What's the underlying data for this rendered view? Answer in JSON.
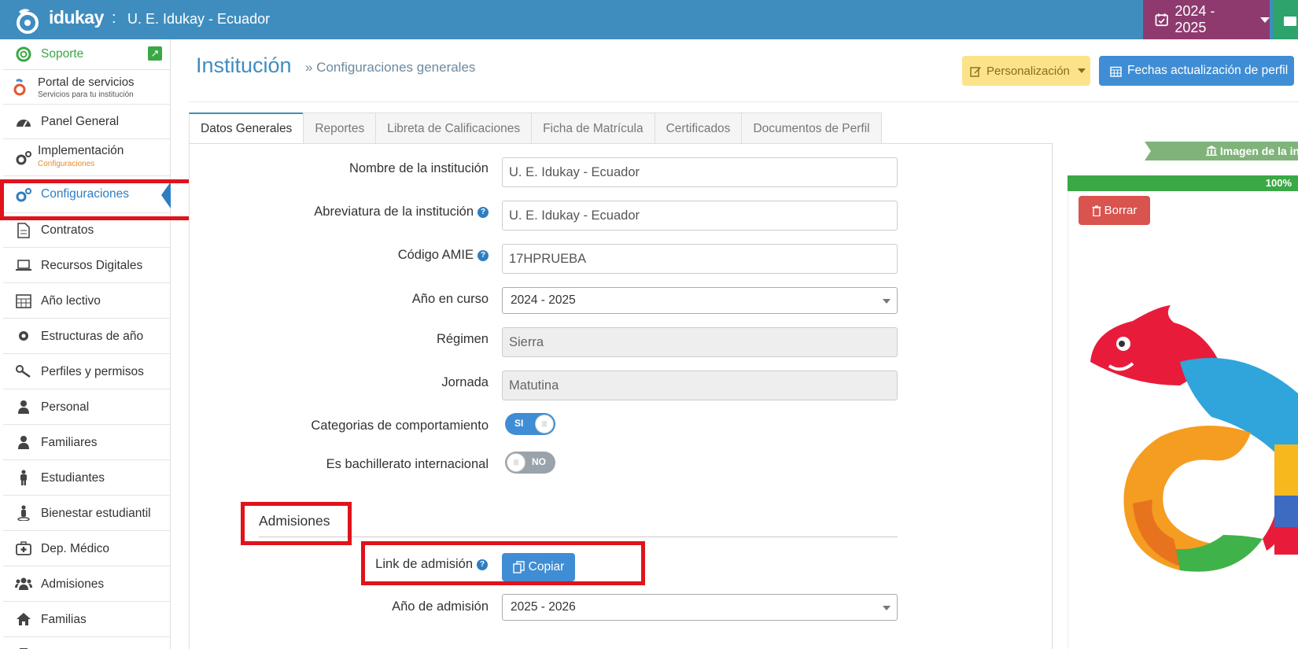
{
  "topbar": {
    "brand": "idukay",
    "separator": ":",
    "institution": "U. E. Idukay - Ecuador",
    "year": "2024 - 2025"
  },
  "sidebar": {
    "items": [
      {
        "label": "Soporte",
        "icon": "lifebuoy-icon"
      },
      {
        "label": "Portal de servicios",
        "sublabel": "Servicios para tu institución",
        "icon": "portal-icon"
      },
      {
        "label": "Panel General",
        "icon": "dashboard-icon"
      },
      {
        "label": "Implementación",
        "sublabel": "Configuraciones",
        "icon": "gears-icon"
      },
      {
        "label": "Configuraciones",
        "icon": "gears-icon",
        "active": true
      },
      {
        "label": "Contratos",
        "icon": "document-icon"
      },
      {
        "label": "Recursos Digitales",
        "icon": "laptop-icon"
      },
      {
        "label": "Año lectivo",
        "icon": "calendar-icon"
      },
      {
        "label": "Estructuras de año",
        "icon": "gear-icon"
      },
      {
        "label": "Perfiles y permisos",
        "icon": "key-icon"
      },
      {
        "label": "Personal",
        "icon": "user-icon"
      },
      {
        "label": "Familiares",
        "icon": "user-icon"
      },
      {
        "label": "Estudiantes",
        "icon": "child-icon"
      },
      {
        "label": "Bienestar estudiantil",
        "icon": "person-icon"
      },
      {
        "label": "Dep. Médico",
        "icon": "medkit-icon"
      },
      {
        "label": "Admisiones",
        "icon": "users-icon"
      },
      {
        "label": "Familias",
        "icon": "home-icon"
      }
    ]
  },
  "header": {
    "title": "Institución",
    "breadcrumb": "» Configuraciones generales",
    "personalizacion": "Personalización",
    "fechas": "Fechas actualización de perfil"
  },
  "tabs": [
    "Datos Generales",
    "Reportes",
    "Libreta de Calificaciones",
    "Ficha de Matrícula",
    "Certificados",
    "Documentos de Perfil"
  ],
  "form": {
    "nombre_label": "Nombre de la institución",
    "nombre_value": "U. E. Idukay - Ecuador",
    "abrev_label": "Abreviatura de la institución",
    "abrev_value": "U. E. Idukay - Ecuador",
    "amie_label": "Código AMIE",
    "amie_value": "17HPRUEBA",
    "anio_label": "Año en curso",
    "anio_value": "2024 - 2025",
    "regimen_label": "Régimen",
    "regimen_value": "Sierra",
    "jornada_label": "Jornada",
    "jornada_value": "Matutina",
    "categorias_label": "Categorias de comportamiento",
    "categorias_toggle": "SI",
    "bachillerato_label": "Es bachillerato internacional",
    "bachillerato_toggle": "NO",
    "admisiones_title": "Admisiones",
    "link_label": "Link de admisión",
    "copiar": "Copiar",
    "anio_admision_label": "Año de admisión",
    "anio_admision_value": "2025 - 2026"
  },
  "image_panel": {
    "banner": "Imagen de la ins",
    "progress": "100%",
    "borrar": "Borrar"
  },
  "colors": {
    "topbar": "#3f8dbf",
    "year_select": "#8e3a6f",
    "accent": "#3f8dd4",
    "highlight": "#e0121b",
    "success": "#3aa845",
    "danger": "#d9534f"
  }
}
